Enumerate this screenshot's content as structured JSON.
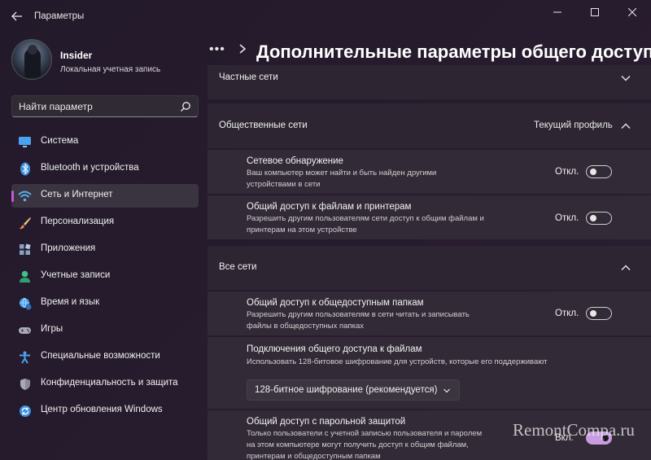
{
  "window": {
    "title": "Параметры"
  },
  "profile": {
    "name": "Insider",
    "account_type": "Локальная учетная запись"
  },
  "search": {
    "placeholder": "Найти параметр"
  },
  "nav": {
    "items": [
      {
        "label": "Система",
        "icon": "monitor-icon",
        "color": "#4aa3f0"
      },
      {
        "label": "Bluetooth и устройства",
        "icon": "bluetooth-icon",
        "color": "#3d8fe0"
      },
      {
        "label": "Сеть и Интернет",
        "icon": "wifi-icon",
        "color": "#5ab0f0",
        "active": true
      },
      {
        "label": "Персонализация",
        "icon": "brush-icon",
        "color": "#e8a060"
      },
      {
        "label": "Приложения",
        "icon": "apps-icon",
        "color": "#8aa0c0"
      },
      {
        "label": "Учетные записи",
        "icon": "person-icon",
        "color": "#3fc08a"
      },
      {
        "label": "Время и язык",
        "icon": "globe-clock-icon",
        "color": "#4aa3f0"
      },
      {
        "label": "Игры",
        "icon": "gamepad-icon",
        "color": "#a8a8b8"
      },
      {
        "label": "Специальные возможности",
        "icon": "accessibility-icon",
        "color": "#4aa3f0"
      },
      {
        "label": "Конфиденциальность и защита",
        "icon": "shield-icon",
        "color": "#8a8a98"
      },
      {
        "label": "Центр обновления Windows",
        "icon": "update-icon",
        "color": "#3d8fe0"
      }
    ]
  },
  "header": {
    "title": "Дополнительные параметры общего доступа"
  },
  "sections": {
    "private": {
      "title": "Частные сети"
    },
    "public": {
      "title": "Общественные сети",
      "profile_tag": "Текущий профиль",
      "network_discovery": {
        "title": "Сетевое обнаружение",
        "desc_line1": "Ваш компьютер может найти и быть найден другими",
        "desc_line2": "устройствами в сети",
        "state": "Откл."
      },
      "file_sharing": {
        "title": "Общий доступ к файлам и принтерам",
        "desc_line1": "Разрешить другим пользователям сети доступ к общим файлам и",
        "desc_line2": "принтерам на этом устройстве",
        "state": "Откл."
      }
    },
    "all": {
      "title": "Все сети",
      "public_folders": {
        "title": "Общий доступ к общедоступным папкам",
        "desc_line1": "Разрешить другим пользователям в сети читать и записывать",
        "desc_line2": "файлы в общедоступных папках",
        "state": "Откл."
      },
      "connections": {
        "title": "Подключения общего доступа к файлам",
        "desc_line1": "Использовать 128-битовое шифрование для устройств, которые его поддерживают",
        "dropdown_value": "128-битное шифрование (рекомендуется)"
      },
      "password": {
        "title": "Общий доступ с парольной защитой",
        "desc_line1": "Только пользователи с учетной записью пользователя и паролем",
        "desc_line2": "на этом компьютере могут получить доступ к общим файлам,",
        "desc_line3": "принтерам и общедоступным папкам",
        "state": "Вкл."
      }
    }
  },
  "watermark": "RemontCompa.ru",
  "colors": {
    "accent": "#c79de0",
    "active_indicator": "#c25ad0"
  }
}
